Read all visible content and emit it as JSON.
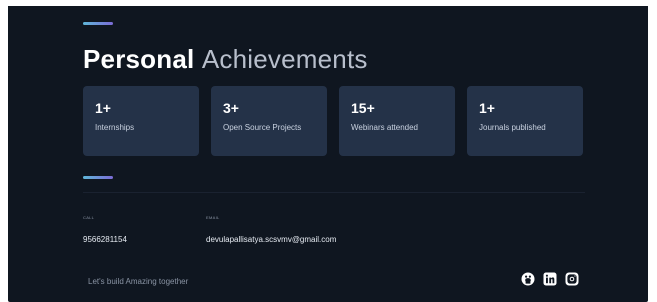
{
  "section": {
    "title_main": "Personal",
    "title_dim": "Achievements"
  },
  "achievements": [
    {
      "value": "1+",
      "label": "Internships"
    },
    {
      "value": "3+",
      "label": "Open Source Projects"
    },
    {
      "value": "15+",
      "label": "Webinars attended"
    },
    {
      "value": "1+",
      "label": "Journals published"
    }
  ],
  "contact": {
    "call_label": "CALL",
    "call_value": "9566281154",
    "email_label": "EMAIL",
    "email_value": "devulapallisatya.scsvmv@gmail.com"
  },
  "footer": {
    "tagline": "Let's build Amazing together"
  },
  "social_icons": [
    "github-icon",
    "linkedin-icon",
    "instagram-icon"
  ],
  "colors": {
    "background": "#0f1620",
    "card": "#243248",
    "accent_start": "#5fb7d9",
    "accent_end": "#7b6bd6"
  }
}
